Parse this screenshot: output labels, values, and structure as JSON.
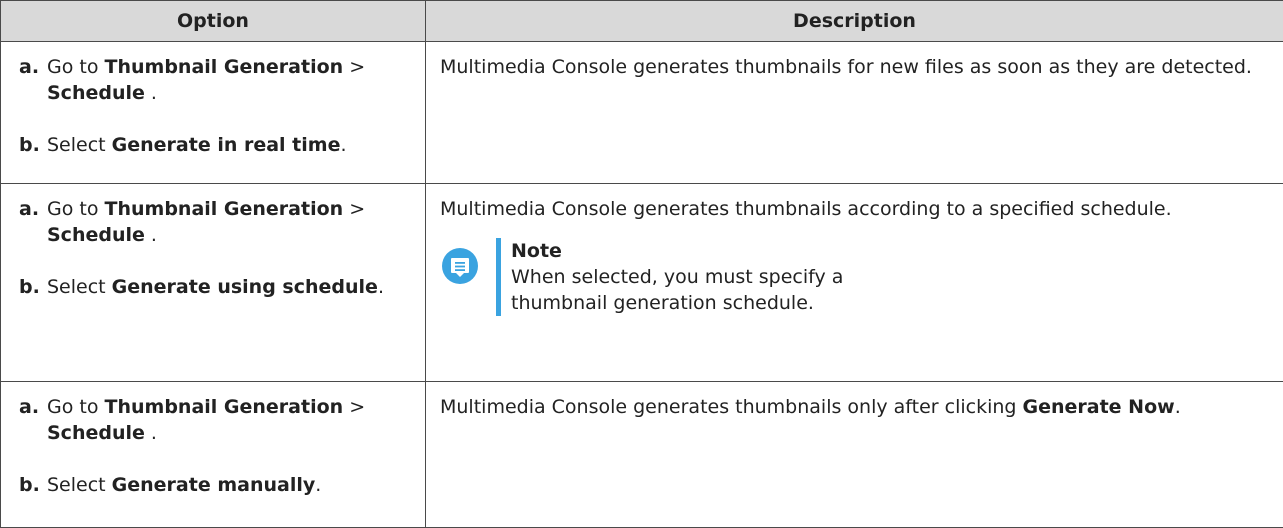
{
  "header": {
    "option": "Option",
    "description": "Description"
  },
  "rows": [
    {
      "step_a": {
        "letter": "a.",
        "pre": "Go to ",
        "bold1": "Thumbnail Generation",
        "mid": " > ",
        "bold2": "Schedule",
        "post": " ."
      },
      "step_b": {
        "letter": "b.",
        "pre": "Select ",
        "bold": "Generate in real time",
        "post": "."
      },
      "description": "Multimedia Console generates thumbnails for new files as soon as they are detected."
    },
    {
      "step_a": {
        "letter": "a.",
        "pre": "Go to ",
        "bold1": "Thumbnail Generation",
        "mid": " > ",
        "bold2": "Schedule",
        "post": " ."
      },
      "step_b": {
        "letter": "b.",
        "pre": "Select ",
        "bold": "Generate using schedule",
        "post": "."
      },
      "description": "Multimedia Console generates thumbnails according to a specified schedule.",
      "note": {
        "icon": "note-icon",
        "title": "Note",
        "text": "When selected, you must specify a thumbnail generation schedule.",
        "accent_color": "#3aa3e0"
      }
    },
    {
      "step_a": {
        "letter": "a.",
        "pre": "Go to ",
        "bold1": "Thumbnail Generation",
        "mid": " > ",
        "bold2": "Schedule",
        "post": " ."
      },
      "step_b": {
        "letter": "b.",
        "pre": "Select ",
        "bold": "Generate manually",
        "post": "."
      },
      "description_pre": "Multimedia Console generates thumbnails only after clicking ",
      "description_bold": "Generate Now",
      "description_post": "."
    }
  ]
}
